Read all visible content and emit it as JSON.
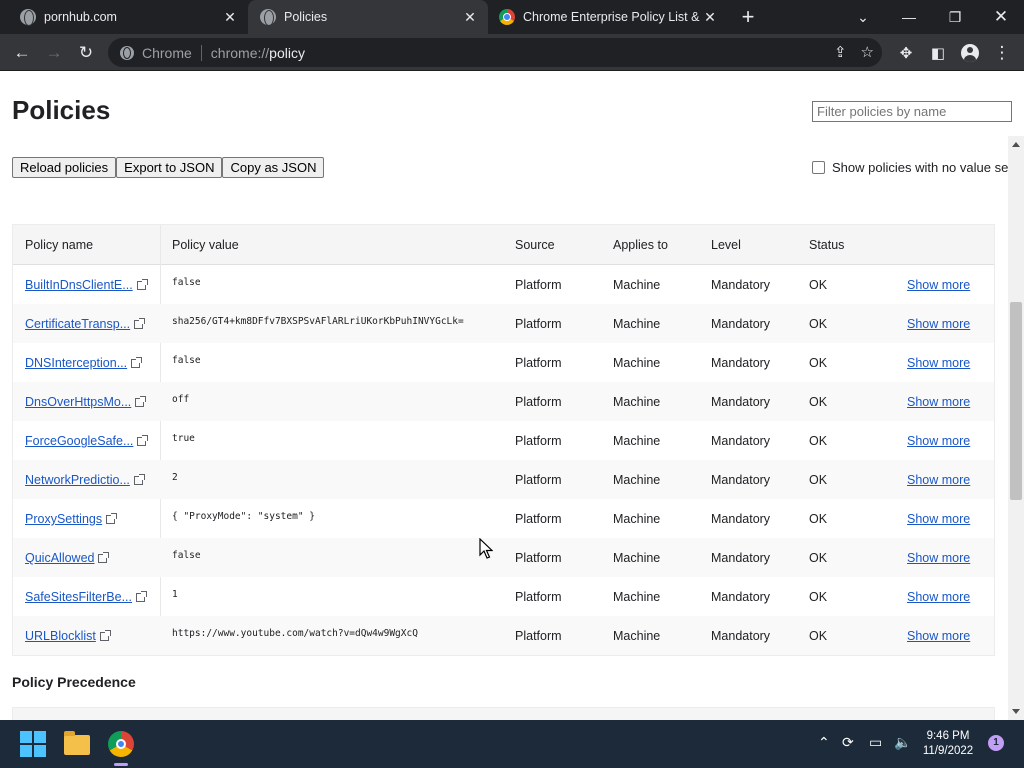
{
  "tabs": [
    {
      "title": "pornhub.com",
      "favicon": "globe-icon",
      "active": false
    },
    {
      "title": "Policies",
      "favicon": "globe-icon",
      "active": true
    },
    {
      "title": "Chrome Enterprise Policy List & M",
      "favicon": "chrome-icon",
      "active": false
    }
  ],
  "toolbar": {
    "chip": "Chrome",
    "url_prefix": "chrome://",
    "url_host": "policy"
  },
  "page": {
    "title": "Policies",
    "filter_placeholder": "Filter policies by name",
    "buttons": {
      "reload": "Reload policies",
      "export_json": "Export to JSON",
      "copy_json": "Copy as JSON"
    },
    "show_no_value": "Show policies with no value set"
  },
  "table": {
    "headers": [
      "Policy name",
      "Policy value",
      "Source",
      "Applies to",
      "Level",
      "Status"
    ],
    "rows": [
      {
        "name": "BuiltInDnsClientE...",
        "value": "false",
        "source": "Platform",
        "scope": "Machine",
        "level": "Mandatory",
        "status": "OK",
        "more": "Show more"
      },
      {
        "name": "CertificateTransp...",
        "value": "sha256/GT4+km8DFfv7BXSPSvAFlARLriUKorKbPuhINVYGcLk=",
        "source": "Platform",
        "scope": "Machine",
        "level": "Mandatory",
        "status": "OK",
        "more": "Show more"
      },
      {
        "name": "DNSInterception...",
        "value": "false",
        "source": "Platform",
        "scope": "Machine",
        "level": "Mandatory",
        "status": "OK",
        "more": "Show more"
      },
      {
        "name": "DnsOverHttpsMo...",
        "value": "off",
        "source": "Platform",
        "scope": "Machine",
        "level": "Mandatory",
        "status": "OK",
        "more": "Show more"
      },
      {
        "name": "ForceGoogleSafe...",
        "value": "true",
        "source": "Platform",
        "scope": "Machine",
        "level": "Mandatory",
        "status": "OK",
        "more": "Show more"
      },
      {
        "name": "NetworkPredictio...",
        "value": "2",
        "source": "Platform",
        "scope": "Machine",
        "level": "Mandatory",
        "status": "OK",
        "more": "Show more"
      },
      {
        "name": "ProxySettings",
        "value": "{ \"ProxyMode\": \"system\" }",
        "source": "Platform",
        "scope": "Machine",
        "level": "Mandatory",
        "status": "OK",
        "more": "Show more"
      },
      {
        "name": "QuicAllowed",
        "value": "false",
        "source": "Platform",
        "scope": "Machine",
        "level": "Mandatory",
        "status": "OK",
        "more": "Show more"
      },
      {
        "name": "SafeSitesFilterBe...",
        "value": "1",
        "source": "Platform",
        "scope": "Machine",
        "level": "Mandatory",
        "status": "OK",
        "more": "Show more"
      },
      {
        "name": "URLBlocklist",
        "value": "https://www.youtube.com/watch?v=dQw4w9WgXcQ",
        "source": "Platform",
        "scope": "Machine",
        "level": "Mandatory",
        "status": "OK",
        "more": "Show more"
      }
    ]
  },
  "precedence": {
    "title": "Policy Precedence"
  },
  "taskbar": {
    "time": "9:46 PM",
    "date": "11/9/2022",
    "notifications": "1"
  },
  "colors": {
    "link": "#1a57c5",
    "tab_bar": "#202124",
    "taskbar": "#1c2a3a"
  }
}
